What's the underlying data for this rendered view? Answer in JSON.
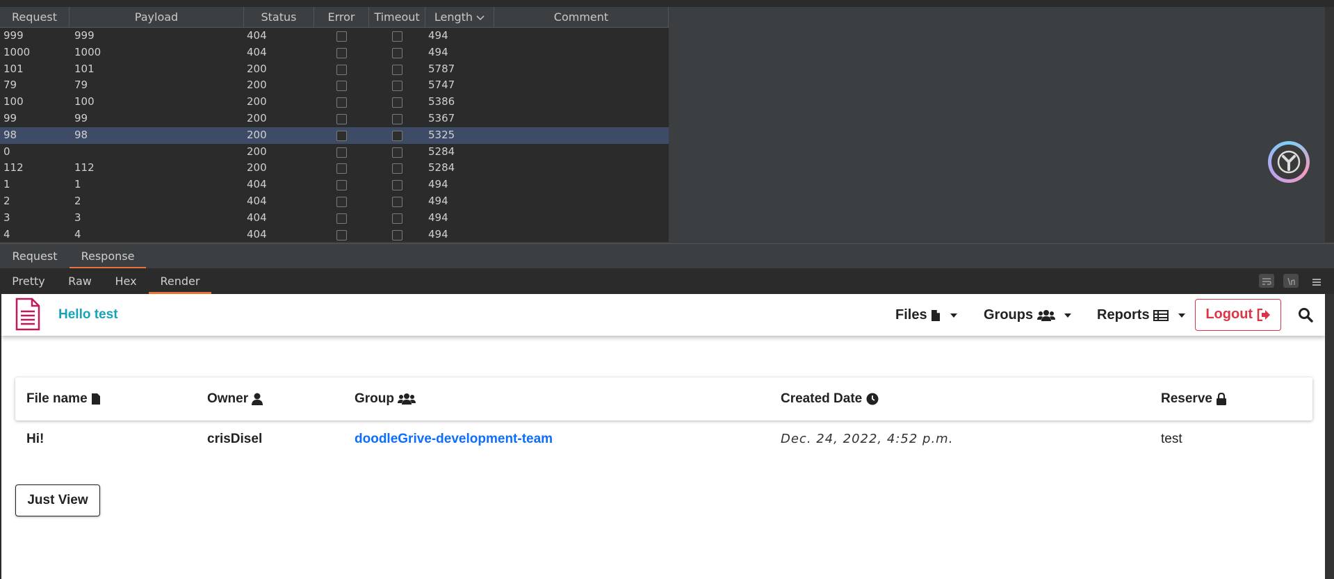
{
  "results": {
    "columns": [
      "Request",
      "Payload",
      "Status",
      "Error",
      "Timeout",
      "Length",
      "Comment"
    ],
    "rows": [
      {
        "request": "999",
        "payload": "999",
        "status": "404",
        "length": "494",
        "selected": false
      },
      {
        "request": "1000",
        "payload": "1000",
        "status": "404",
        "length": "494",
        "selected": false
      },
      {
        "request": "101",
        "payload": "101",
        "status": "200",
        "length": "5787",
        "selected": false
      },
      {
        "request": "79",
        "payload": "79",
        "status": "200",
        "length": "5747",
        "selected": false
      },
      {
        "request": "100",
        "payload": "100",
        "status": "200",
        "length": "5386",
        "selected": false
      },
      {
        "request": "99",
        "payload": "99",
        "status": "200",
        "length": "5367",
        "selected": false
      },
      {
        "request": "98",
        "payload": "98",
        "status": "200",
        "length": "5325",
        "selected": true
      },
      {
        "request": "0",
        "payload": "",
        "status": "200",
        "length": "5284",
        "selected": false
      },
      {
        "request": "112",
        "payload": "112",
        "status": "200",
        "length": "5284",
        "selected": false
      },
      {
        "request": "1",
        "payload": "1",
        "status": "404",
        "length": "494",
        "selected": false
      },
      {
        "request": "2",
        "payload": "2",
        "status": "404",
        "length": "494",
        "selected": false
      },
      {
        "request": "3",
        "payload": "3",
        "status": "404",
        "length": "494",
        "selected": false
      },
      {
        "request": "4",
        "payload": "4",
        "status": "404",
        "length": "494",
        "selected": false
      }
    ]
  },
  "reqresp_tabs": [
    "Request",
    "Response"
  ],
  "view_tabs": [
    "Pretty",
    "Raw",
    "Hex",
    "Render"
  ],
  "render": {
    "brand": "Hello test",
    "nav": {
      "files": "Files",
      "groups": "Groups",
      "reports": "Reports",
      "logout": "Logout"
    },
    "table": {
      "headers": [
        "File name",
        "Owner",
        "Group",
        "Created Date",
        "Reserve"
      ],
      "row": {
        "file_name": "Hi!",
        "owner": "crisDisel",
        "group": "doodleGrive-development-team",
        "created": "Dec. 24, 2022, 4:52 p.m.",
        "reserve": "test"
      }
    },
    "just_view": "Just View"
  },
  "colors": {
    "accent_tab": "#e8743b",
    "selected_row": "#3e4b67",
    "brand": "#17a2b8",
    "logout": "#dc3545",
    "link": "#0d6efd"
  }
}
